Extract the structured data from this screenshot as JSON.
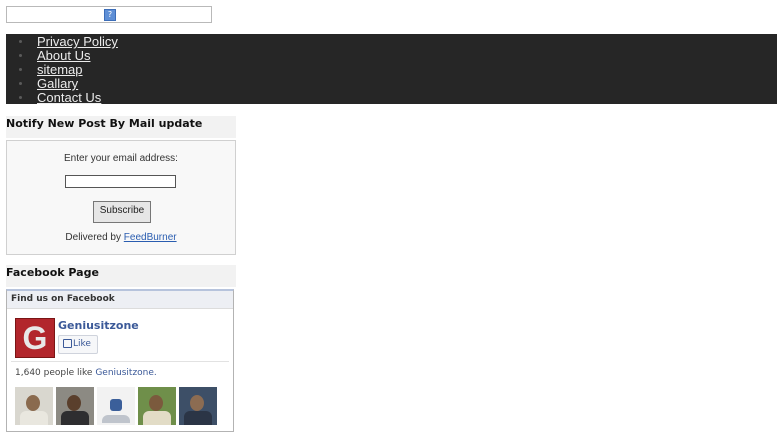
{
  "search": {
    "icon": "search-icon"
  },
  "nav": {
    "items": [
      {
        "label": "Privacy Policy"
      },
      {
        "label": "About Us"
      },
      {
        "label": "sitemap"
      },
      {
        "label": "Gallary"
      },
      {
        "label": "Contact Us"
      }
    ]
  },
  "notify_widget": {
    "title": "Notify New Post By Mail update",
    "label": "Enter your email address:",
    "input_value": "",
    "button": "Subscribe",
    "delivered_prefix": "Delivered by",
    "delivered_link": "FeedBurner"
  },
  "facebook_widget": {
    "title": "Facebook Page",
    "header": "Find us on Facebook",
    "logo_letter": "G",
    "page_name": "Geniusitzone",
    "like_button": "Like",
    "count_prefix": "1,640 people like",
    "count_link": "Geniusitzone.",
    "faces": [
      {
        "icon": "user-photo-1"
      },
      {
        "icon": "user-photo-2"
      },
      {
        "icon": "user-photo-3"
      },
      {
        "icon": "user-photo-4"
      },
      {
        "icon": "user-photo-5"
      }
    ]
  },
  "colors": {
    "nav_bg": "#262626",
    "link": "#3b5998",
    "logo_red": "#b2262c"
  }
}
